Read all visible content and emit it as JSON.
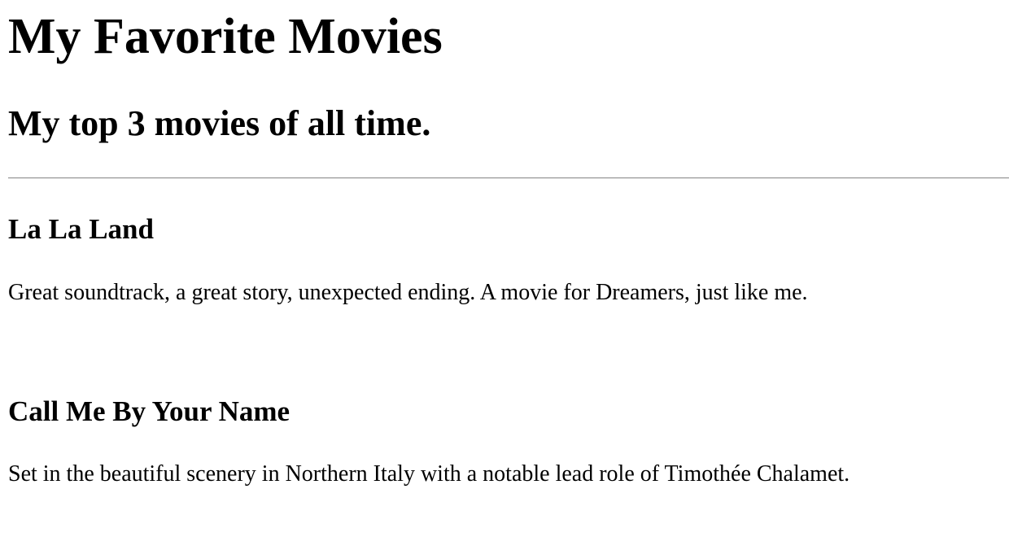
{
  "page": {
    "title": "My Favorite Movies",
    "subtitle": "My top 3 movies of all time."
  },
  "movies": [
    {
      "title": "La La Land",
      "description": "Great soundtrack, a great story, unexpected ending. A movie for Dreamers, just like me."
    },
    {
      "title": "Call Me By Your Name",
      "description": "Set in the beautiful scenery in Northern Italy with a notable lead role of Timothée Chalamet."
    }
  ]
}
